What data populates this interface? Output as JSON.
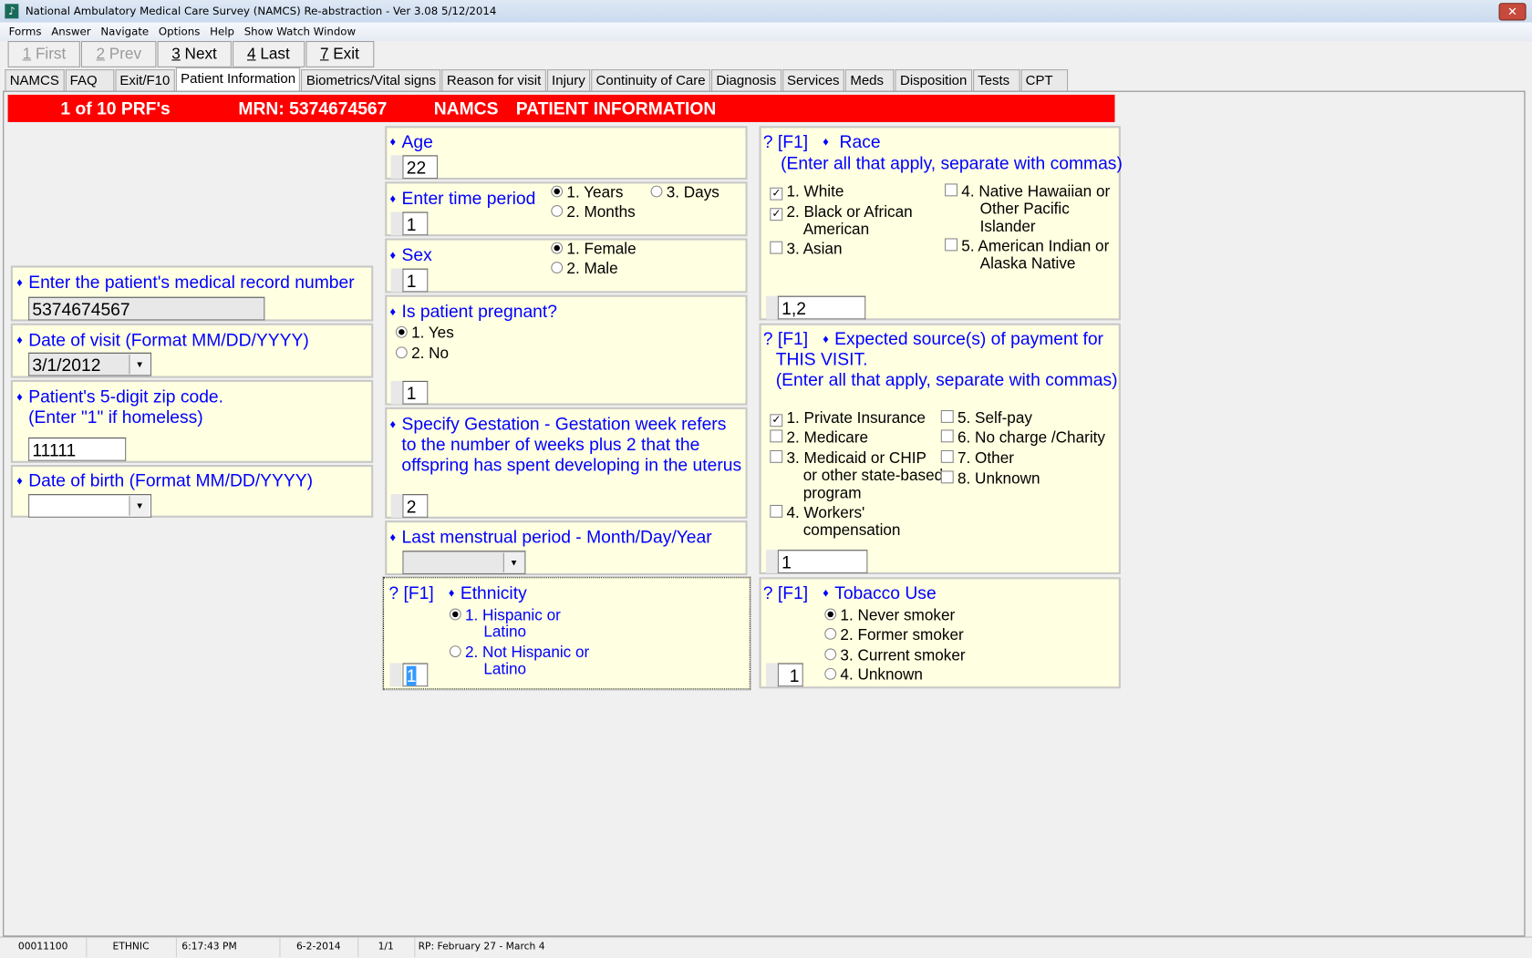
{
  "window": {
    "title": "National Ambulatory Medical Care Survey (NAMCS) Re-abstraction  - Ver 3.08 5/12/2014",
    "close": "✕"
  },
  "menu": [
    "Forms",
    "Answer",
    "Navigate",
    "Options",
    "Help",
    "Show Watch Window"
  ],
  "toolbar": [
    {
      "key": "1",
      "label": " First"
    },
    {
      "key": "2",
      "label": " Prev"
    },
    {
      "key": "3",
      "label": " Next"
    },
    {
      "key": "4",
      "label": " Last"
    },
    {
      "key": "7",
      "label": " Exit"
    }
  ],
  "tabs": [
    "NAMCS",
    "FAQ",
    "Exit/F10",
    "Patient Information",
    "Biometrics/Vital signs",
    "Reason for visit",
    "Injury",
    "Continuity of Care",
    "Diagnosis",
    "Services",
    "Meds",
    "Disposition",
    "Tests",
    "CPT"
  ],
  "header": {
    "count": "1 of 10   PRF's",
    "mrn": "MRN: 5374674567",
    "namcs": "NAMCS",
    "section": "PATIENT INFORMATION"
  },
  "help": "? [F1]",
  "diamond": "♦",
  "mrn": {
    "label": "Enter the patient's medical record number",
    "value": "5374674567"
  },
  "visit_date": {
    "label": "Date of visit (Format MM/DD/YYYY)",
    "value": "3/1/2012"
  },
  "zip": {
    "label1": "Patient's 5-digit zip code.",
    "label2": "(Enter \"1\" if homeless)",
    "value": "11111"
  },
  "dob": {
    "label": "Date of birth (Format MM/DD/YYYY)",
    "value": ""
  },
  "age": {
    "label": "Age",
    "value": "22"
  },
  "time_period": {
    "label": "Enter time period",
    "options": [
      "1. Years",
      "2. Months",
      "3. Days"
    ],
    "value": "1"
  },
  "sex": {
    "label": "Sex",
    "options": [
      "1. Female",
      "2. Male"
    ],
    "value": "1"
  },
  "pregnant": {
    "label": "Is patient pregnant?",
    "options": [
      "1. Yes",
      "2. No"
    ],
    "value": "1"
  },
  "gestation": {
    "l1": "Specify Gestation - Gestation week refers",
    "l2": "to the number of weeks plus 2 that the",
    "l3": "offspring has spent developing in the uterus",
    "value": "2"
  },
  "lmp": {
    "label": "Last menstrual period - Month/Day/Year",
    "value": ""
  },
  "ethnicity": {
    "label": "Ethnicity",
    "o1a": "1. Hispanic or",
    "o1b": "Latino",
    "o2a": "2. Not Hispanic or",
    "o2b": "Latino",
    "value": "1"
  },
  "race": {
    "label": "Race",
    "sub": "(Enter all that apply, separate with commas)",
    "o1": "1.  White",
    "o2a": "2.  Black or African",
    "o2b": "American",
    "o3": "3.  Asian",
    "o4a": "4.  Native Hawaiian or",
    "o4b": "Other Pacific",
    "o4c": "Islander",
    "o5a": "5.  American Indian or",
    "o5b": "Alaska Native",
    "value": "1,2"
  },
  "payment": {
    "label": "Expected source(s) of payment for",
    "l2": "THIS VISIT.",
    "sub": "(Enter all that apply, separate with commas)",
    "o1": "1.  Private Insurance",
    "o2": "2.  Medicare",
    "o3a": "3.  Medicaid or CHIP",
    "o3b": "or other state-based",
    "o3c": "program",
    "o4a": "4.  Workers'",
    "o4b": "compensation",
    "o5": "5.  Self-pay",
    "o6": "6.  No charge /Charity",
    "o7": "7.  Other",
    "o8": "8.  Unknown",
    "value": "1"
  },
  "tobacco": {
    "label": "Tobacco Use",
    "options": [
      "1.  Never smoker",
      "2.  Former smoker",
      "3.  Current smoker",
      "4.  Unknown"
    ],
    "value": "1"
  },
  "status": {
    "code": "00011100",
    "field": "ETHNIC",
    "time": "6:17:43 PM",
    "date": "6-2-2014",
    "page": "1/1",
    "rp": "RP: February 27 - March 4"
  },
  "colors": {
    "header": "#ff0000",
    "panel": "#ffffe1",
    "question": "#0000ff"
  }
}
